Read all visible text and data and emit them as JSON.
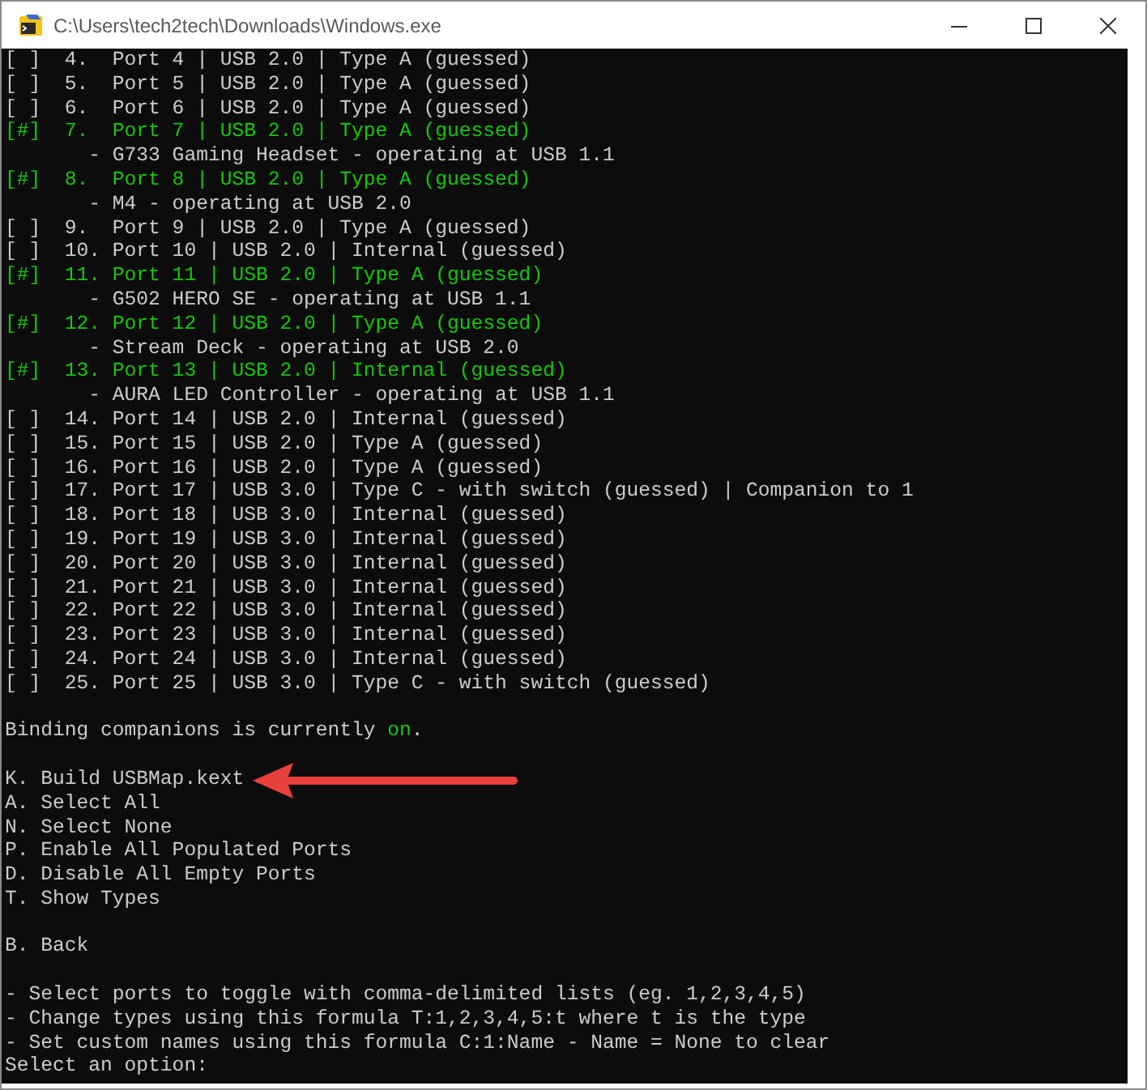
{
  "window": {
    "title": "C:\\Users\\tech2tech\\Downloads\\Windows.exe"
  },
  "lines": [
    {
      "kind": "port",
      "selected": false,
      "text": "[ ]  4.  Port 4 | USB 2.0 | Type A (guessed)"
    },
    {
      "kind": "port",
      "selected": false,
      "text": "[ ]  5.  Port 5 | USB 2.0 | Type A (guessed)"
    },
    {
      "kind": "port",
      "selected": false,
      "text": "[ ]  6.  Port 6 | USB 2.0 | Type A (guessed)"
    },
    {
      "kind": "port",
      "selected": true,
      "text": "[#]  7.  Port 7 | USB 2.0 | Type A (guessed)"
    },
    {
      "kind": "device",
      "text": "       - G733 Gaming Headset - operating at USB 1.1"
    },
    {
      "kind": "port",
      "selected": true,
      "text": "[#]  8.  Port 8 | USB 2.0 | Type A (guessed)"
    },
    {
      "kind": "device",
      "text": "       - M4 - operating at USB 2.0"
    },
    {
      "kind": "port",
      "selected": false,
      "text": "[ ]  9.  Port 9 | USB 2.0 | Type A (guessed)"
    },
    {
      "kind": "port",
      "selected": false,
      "text": "[ ]  10. Port 10 | USB 2.0 | Internal (guessed)"
    },
    {
      "kind": "port",
      "selected": true,
      "text": "[#]  11. Port 11 | USB 2.0 | Type A (guessed)"
    },
    {
      "kind": "device",
      "text": "       - G502 HERO SE - operating at USB 1.1"
    },
    {
      "kind": "port",
      "selected": true,
      "text": "[#]  12. Port 12 | USB 2.0 | Type A (guessed)"
    },
    {
      "kind": "device",
      "text": "       - Stream Deck - operating at USB 2.0"
    },
    {
      "kind": "port",
      "selected": true,
      "text": "[#]  13. Port 13 | USB 2.0 | Internal (guessed)"
    },
    {
      "kind": "device",
      "text": "       - AURA LED Controller - operating at USB 1.1"
    },
    {
      "kind": "port",
      "selected": false,
      "text": "[ ]  14. Port 14 | USB 2.0 | Internal (guessed)"
    },
    {
      "kind": "port",
      "selected": false,
      "text": "[ ]  15. Port 15 | USB 2.0 | Type A (guessed)"
    },
    {
      "kind": "port",
      "selected": false,
      "text": "[ ]  16. Port 16 | USB 2.0 | Type A (guessed)"
    },
    {
      "kind": "port",
      "selected": false,
      "text": "[ ]  17. Port 17 | USB 3.0 | Type C - with switch (guessed) | Companion to 1"
    },
    {
      "kind": "port",
      "selected": false,
      "text": "[ ]  18. Port 18 | USB 3.0 | Internal (guessed)"
    },
    {
      "kind": "port",
      "selected": false,
      "text": "[ ]  19. Port 19 | USB 3.0 | Internal (guessed)"
    },
    {
      "kind": "port",
      "selected": false,
      "text": "[ ]  20. Port 20 | USB 3.0 | Internal (guessed)"
    },
    {
      "kind": "port",
      "selected": false,
      "text": "[ ]  21. Port 21 | USB 3.0 | Internal (guessed)"
    },
    {
      "kind": "port",
      "selected": false,
      "text": "[ ]  22. Port 22 | USB 3.0 | Internal (guessed)"
    },
    {
      "kind": "port",
      "selected": false,
      "text": "[ ]  23. Port 23 | USB 3.0 | Internal (guessed)"
    },
    {
      "kind": "port",
      "selected": false,
      "text": "[ ]  24. Port 24 | USB 3.0 | Internal (guessed)"
    },
    {
      "kind": "port",
      "selected": false,
      "text": "[ ]  25. Port 25 | USB 3.0 | Type C - with switch (guessed)"
    },
    {
      "kind": "blank"
    },
    {
      "kind": "status",
      "text": "Binding companions is currently ",
      "value": "on",
      "on": true,
      "end": "."
    },
    {
      "kind": "blank"
    },
    {
      "kind": "option",
      "text": "K. Build USBMap.kext",
      "arrow": true
    },
    {
      "kind": "option",
      "text": "A. Select All"
    },
    {
      "kind": "option",
      "text": "N. Select None"
    },
    {
      "kind": "option",
      "text": "P. Enable All Populated Ports"
    },
    {
      "kind": "option",
      "text": "D. Disable All Empty Ports"
    },
    {
      "kind": "option",
      "text": "T. Show Types"
    },
    {
      "kind": "blank"
    },
    {
      "kind": "option",
      "text": "B. Back"
    },
    {
      "kind": "blank"
    },
    {
      "kind": "hint",
      "text": "- Select ports to toggle with comma-delimited lists (eg. 1,2,3,4,5)"
    },
    {
      "kind": "hint",
      "text": "- Change types using this formula T:1,2,3,4,5:t where t is the type"
    },
    {
      "kind": "hint",
      "text": "- Set custom names using this formula C:1:Name - Name = None to clear"
    },
    {
      "kind": "prompt",
      "text": "Select an option:"
    }
  ]
}
